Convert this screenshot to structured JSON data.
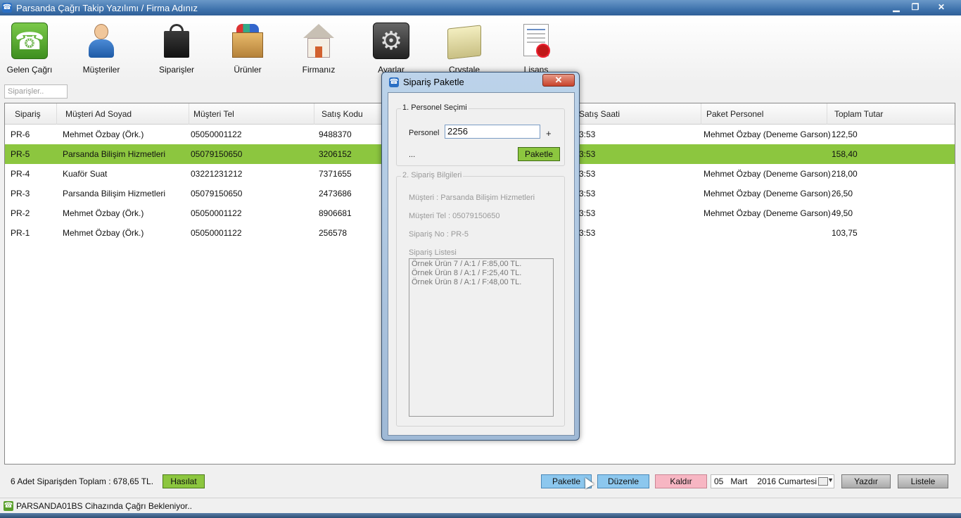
{
  "window": {
    "title": "Parsanda Çağrı Takip Yazılımı / Firma Adınız",
    "min_label": "▁",
    "max_label": "❐",
    "close_label": "✕"
  },
  "toolbar": {
    "items": [
      {
        "label": "Gelen Çağrı",
        "icon": "phone-icon"
      },
      {
        "label": "Müşteriler",
        "icon": "customer-icon"
      },
      {
        "label": "Siparişler",
        "icon": "shopping-bag-icon"
      },
      {
        "label": "Ürünler",
        "icon": "product-box-icon"
      },
      {
        "label": "Firmanız",
        "icon": "house-icon"
      },
      {
        "label": "Ayarlar",
        "icon": "settings-gear-icon"
      },
      {
        "label": "Crystale",
        "icon": "folder-icon"
      },
      {
        "label": "Lisans",
        "icon": "certificate-icon"
      }
    ]
  },
  "search": {
    "placeholder": "Siparişler.."
  },
  "grid": {
    "columns": [
      "Sipariş",
      "Müşteri Ad Soyad",
      "Müşteri Tel",
      "Satış Kodu",
      "Satış Saati",
      "Paket Personel",
      "Toplam Tutar"
    ],
    "rows": [
      {
        "siparis": "PR-6",
        "ad": "Mehmet Özbay (Örk.)",
        "tel": "05050001122",
        "kod": "9488370",
        "saat": "3:53",
        "personel": "Mehmet Özbay (Deneme Garson)",
        "tutar": "122,50",
        "selected": false
      },
      {
        "siparis": "PR-5",
        "ad": "Parsanda Bilişim Hizmetleri",
        "tel": "05079150650",
        "kod": "3206152",
        "saat": "3:53",
        "personel": "",
        "tutar": "158,40",
        "selected": true
      },
      {
        "siparis": "PR-4",
        "ad": "Kuaför Suat",
        "tel": "03221231212",
        "kod": "7371655",
        "saat": "3:53",
        "personel": "Mehmet Özbay (Deneme Garson)",
        "tutar": "218,00",
        "selected": false
      },
      {
        "siparis": "PR-3",
        "ad": "Parsanda Bilişim Hizmetleri",
        "tel": "05079150650",
        "kod": "2473686",
        "saat": "3:53",
        "personel": "Mehmet Özbay (Deneme Garson)",
        "tutar": "26,50",
        "selected": false
      },
      {
        "siparis": "PR-2",
        "ad": "Mehmet Özbay (Örk.)",
        "tel": "05050001122",
        "kod": "8906681",
        "saat": "3:53",
        "personel": "Mehmet Özbay (Deneme Garson)",
        "tutar": "49,50",
        "selected": false
      },
      {
        "siparis": "PR-1",
        "ad": "Mehmet Özbay (Örk.)",
        "tel": "05050001122",
        "kod": "256578",
        "saat": "3:53",
        "personel": "",
        "tutar": "103,75",
        "selected": false
      }
    ]
  },
  "footer": {
    "summary": "6 Adet Siparişden Toplam : 678,65 TL.",
    "hasilat": "Hasılat",
    "paketle": "Paketle",
    "duzenle": "Düzenle",
    "kaldir": "Kaldır",
    "date_day": "05",
    "date_month": "Mart",
    "date_rest": "2016 Cumartesi",
    "yazdir": "Yazdır",
    "listele": "Listele"
  },
  "status": {
    "text": "PARSANDA01BS Cihazında Çağrı Bekleniyor.."
  },
  "dialog": {
    "title": "Sipariş Paketle",
    "close": "✕",
    "group1_title": "1. Personel Seçimi",
    "personel_label": "Personel",
    "personel_value": "2256",
    "plus": "+",
    "ellipsis": "...",
    "paketle": "Paketle",
    "group2_title": "2. Sipariş Bilgileri",
    "musteri": "Müşteri : Parsanda Bilişim Hizmetleri",
    "tel": "Müşteri Tel  : 05079150650",
    "siparis_no": "Sipariş No : PR-5",
    "liste_label": "Sipariş Listesi",
    "order_items": [
      "Örnek Ürün 7 / A:1 / F:85,00 TL.",
      "Örnek Ürün 8 / A:1 / F:25,40 TL.",
      "Örnek Ürün 8 / A:1 / F:48,00 TL."
    ]
  },
  "colors": {
    "accent_green": "#8cc63f",
    "accent_blue": "#8cc7ee",
    "accent_pink": "#f7b6c3",
    "titlebar_blue": "#3f73ad"
  }
}
